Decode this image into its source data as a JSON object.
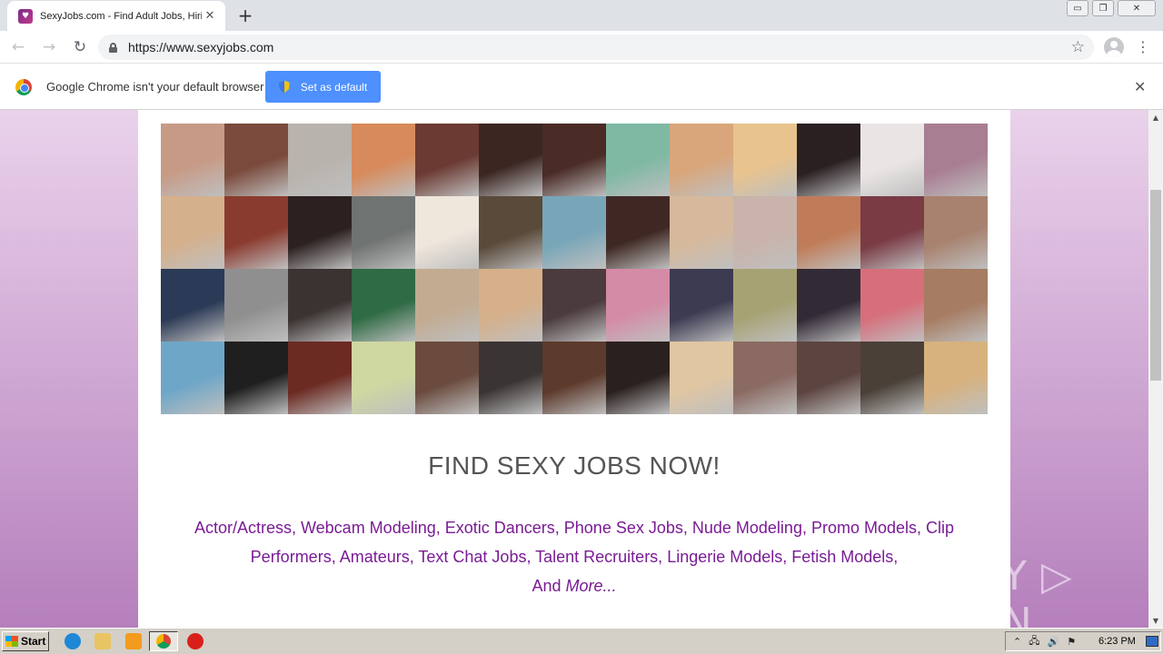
{
  "browser": {
    "tab_title": "SexyJobs.com - Find Adult Jobs, Hiring",
    "favicon_glyph": "♥",
    "new_tab_glyph": "+",
    "window_controls": [
      "▭",
      "❐",
      "✕"
    ],
    "nav": {
      "back": "←",
      "forward": "→",
      "reload": "↻"
    },
    "url": "https://www.sexyjobs.com",
    "bookmark_glyph": "☆",
    "menu_glyph": "⋮"
  },
  "infobar": {
    "message": "Google Chrome isn't your default browser",
    "button_label": "Set as default",
    "close_glyph": "✕"
  },
  "page": {
    "headline": "FIND SEXY JOBS NOW!",
    "job_categories": "Actor/Actress, Webcam Modeling, Exotic Dancers, Phone Sex Jobs, Nude Modeling, Promo Models, Clip Performers, Amateurs, Text Chat Jobs, Talent Recruiters, Lingerie Models, Fetish Models,",
    "and_label": "And",
    "more_label": "More...",
    "photo_grid": {
      "columns": 13,
      "rows": 4,
      "tile_colors": [
        "#c79a86",
        "#7a4a3c",
        "#b9b3ad",
        "#d78a5c",
        "#6b3a32",
        "#3b2622",
        "#4a2b26",
        "#7fb9a4",
        "#d9a67b",
        "#e8c38d",
        "#2a2022",
        "#e9e5e4",
        "#a87e92",
        "#d5b08c",
        "#8a3b2f",
        "#2c2020",
        "#6f7372",
        "#efe6dc",
        "#5a4a3a",
        "#78a6b8",
        "#3f2823",
        "#d6b99c",
        "#c9b3aa",
        "#c07c59",
        "#7a3b45",
        "#a8826f",
        "#2b3a56",
        "#8f8f8f",
        "#3a3331",
        "#2f6b44",
        "#c2ab91",
        "#d5b08a",
        "#4b3b3e",
        "#d48ba6",
        "#3c3b52",
        "#a7a274",
        "#322a36",
        "#d66f7b",
        "#a67c62",
        "#6ea6c8",
        "#1f1f1f",
        "#6b2a22",
        "#cfd8a1",
        "#6a4b3e",
        "#3b3434",
        "#5c3a2c",
        "#2a211f",
        "#e1c6a2",
        "#8a6a62",
        "#5c4440",
        "#4a4038",
        "#d7b27e"
      ]
    },
    "watermark": "ANY ▷ RUN"
  },
  "scrollbar": {
    "up_glyph": "▲",
    "down_glyph": "▼"
  },
  "taskbar": {
    "start_label": "Start",
    "tray_glyphs": [
      "⌃",
      "🖧",
      "🔊",
      "⚑"
    ],
    "clock": "6:23 PM"
  },
  "colors": {
    "accent": "#4d90fe",
    "job_link": "#7a1b95",
    "page_bg_top": "#ead2eb",
    "page_bg_bottom": "#b57fbc"
  }
}
